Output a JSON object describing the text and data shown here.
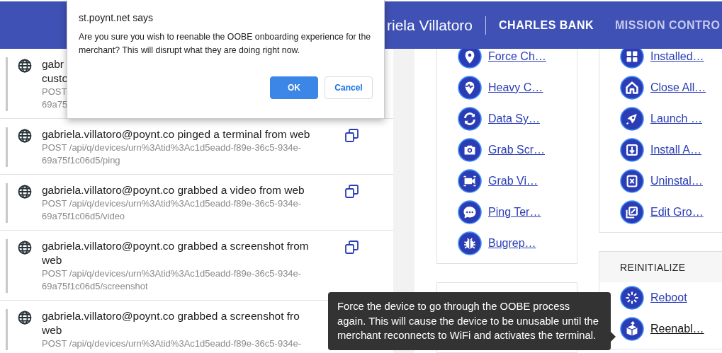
{
  "header": {
    "user": "riela Villatoro",
    "merchant": "CHARLES BANK",
    "nav": "MISSION CONTRO"
  },
  "activity": [
    {
      "title": "gabr\ncusto",
      "request": "POST\n69a75",
      "copy_button": false
    },
    {
      "title": "gabriela.villatoro@poynt.co pinged a terminal from web",
      "request": "POST /api/q/devices/urn%3Atid%3Ac1d5eadd-f89e-36c5-934e-\n69a75f1c06d5/ping",
      "copy_button": true
    },
    {
      "title": "gabriela.villatoro@poynt.co grabbed a video from web",
      "request": "POST /api/q/devices/urn%3Atid%3Ac1d5eadd-f89e-36c5-934e-\n69a75f1c06d5/video",
      "copy_button": true
    },
    {
      "title": "gabriela.villatoro@poynt.co grabbed a screenshot from\nweb",
      "request": "POST /api/q/devices/urn%3Atid%3Ac1d5eadd-f89e-36c5-934e-\n69a75f1c06d5/screenshot",
      "copy_button": true
    },
    {
      "title": "gabriela.villatoro@poynt.co grabbed a screenshot fro\nweb",
      "request": "POST /api/q/devices/urn%3Atid%3Ac1d5eadd-f89e-36c5-934e-",
      "copy_button": false
    }
  ],
  "device_actions": [
    {
      "label": "Force Ch…"
    },
    {
      "label": "Heavy C…"
    },
    {
      "label": "Data Sy…"
    },
    {
      "label": "Grab Scr…"
    },
    {
      "label": "Grab Vi…"
    },
    {
      "label": "Ping Ter…"
    },
    {
      "label": "Bugrep…"
    }
  ],
  "app_actions": [
    {
      "label": "Installed…"
    },
    {
      "label": "Close All…"
    },
    {
      "label": "Launch …"
    },
    {
      "label": "Install A…"
    },
    {
      "label": "Uninstal…"
    },
    {
      "label": "Edit Gro…"
    }
  ],
  "reinitialize": {
    "title": "REINITIALIZE",
    "items": [
      {
        "label": "Reboot",
        "hovered": false
      },
      {
        "label": "Reenabl…",
        "hovered": true
      }
    ]
  },
  "tooltip": "Force the device to go through the OOBE process again. This will cause the device to be unusable until the merchant reconnects to WiFi and activates the terminal.",
  "dialog": {
    "origin": "st.poynt.net says",
    "message": "Are you sure you wish to reenable the OOBE onboarding experience for the merchant? This will disrupt what they are doing right now.",
    "buttons": [
      {
        "label": "OK",
        "primary": true
      },
      {
        "label": "Cancel",
        "primary": false
      }
    ]
  }
}
